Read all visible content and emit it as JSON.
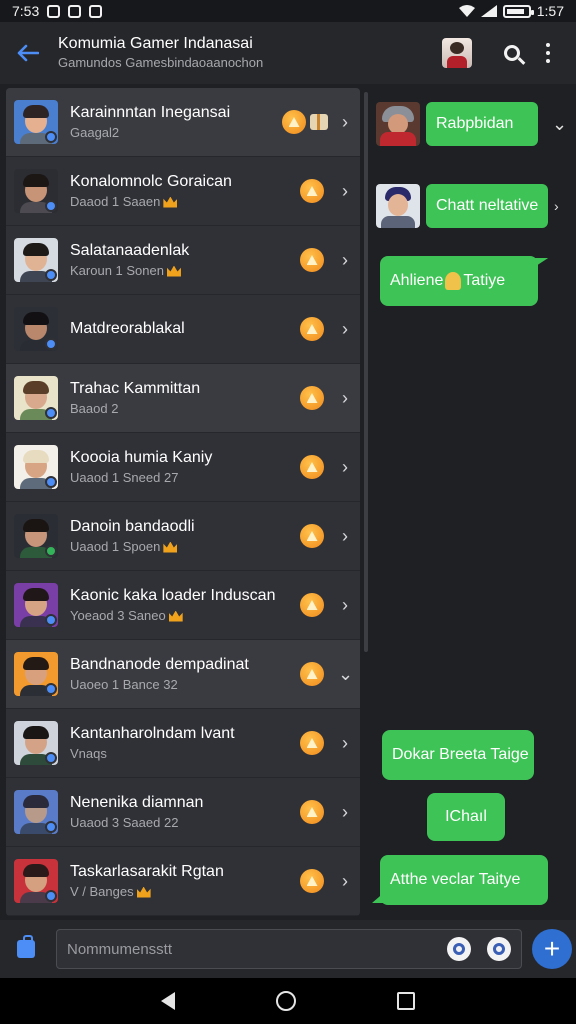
{
  "status_bar": {
    "time": "7:53",
    "right_text": "1:57"
  },
  "app_bar": {
    "title": "Komumia Gamer Indanasai",
    "subtitle": "Gamundos Gamesbindaoaanochon"
  },
  "list": [
    {
      "name": "Karainnntan Inegansai",
      "sub": "Gaagal2",
      "crown": false,
      "gift": true,
      "chevron": "›"
    },
    {
      "name": "Konalomnolc Goraican",
      "sub": "Daaod 1 Saaen",
      "crown": true,
      "gift": false,
      "chevron": "›"
    },
    {
      "name": "Salatanaadenlak",
      "sub": "Karoun 1 Sonen",
      "crown": true,
      "gift": false,
      "chevron": "›"
    },
    {
      "name": "Matdreorablakal",
      "sub": "",
      "crown": false,
      "gift": false,
      "chevron": "›"
    },
    {
      "name": "Trahac Kammittan",
      "sub": "Baaod 2",
      "crown": false,
      "gift": false,
      "chevron": "›"
    },
    {
      "name": "Koooia humia Kaniy",
      "sub": "Uaaod 1 Sneed 27",
      "crown": false,
      "gift": false,
      "chevron": "›"
    },
    {
      "name": "Danoin bandaodli",
      "sub": "Uaaod 1 Spoen",
      "crown": true,
      "gift": false,
      "chevron": "›"
    },
    {
      "name": "Kaonic kaka loader Induscan",
      "sub": "Yoeaod 3 Saneo",
      "crown": true,
      "gift": false,
      "chevron": "›"
    },
    {
      "name": "Bandnanode dempadinat",
      "sub": "Uaoeo 1 Bance 32",
      "crown": false,
      "gift": false,
      "chevron": "⌄"
    },
    {
      "name": "Kantanharolndam lvant",
      "sub": "Vnaqs",
      "crown": false,
      "gift": false,
      "chevron": "›"
    },
    {
      "name": "Nenenika diamnan",
      "sub": "Uaaod 3 Saaed 22",
      "crown": false,
      "gift": false,
      "chevron": "›"
    },
    {
      "name": "Taskarlasarakit Rgtan",
      "sub": "V / Banges",
      "crown": true,
      "gift": false,
      "chevron": "›"
    }
  ],
  "chat": {
    "messages": [
      {
        "text": "Rabpbidan",
        "has_avatar": true
      },
      {
        "text": "Chatt neltative",
        "has_avatar": true
      },
      {
        "text_a": "Ahliene",
        "text_b": "Tatiye",
        "has_avatar": false
      },
      {
        "text": "Dokar Breeta Taige",
        "has_avatar": false
      },
      {
        "text": "IChaıl",
        "has_avatar": false
      },
      {
        "text": "Atthe veclar Taitye",
        "has_avatar": false
      }
    ],
    "expand_icon": "⌄",
    "side_chevron": "›"
  },
  "input": {
    "placeholder": "Nommumensstt"
  },
  "fab": {
    "label": "+"
  },
  "colors": {
    "accent": "#4c8df6",
    "bubble": "#3ec356",
    "star": "#f08a1c"
  },
  "icons": [
    "back-arrow-icon",
    "search-icon",
    "more-vert-icon",
    "chevron-right-icon",
    "star-badge-icon",
    "crown-icon",
    "attach-icon",
    "emoji-icon",
    "camera-icon",
    "plus-icon",
    "nav-back-icon",
    "nav-home-icon",
    "nav-recent-icon"
  ]
}
